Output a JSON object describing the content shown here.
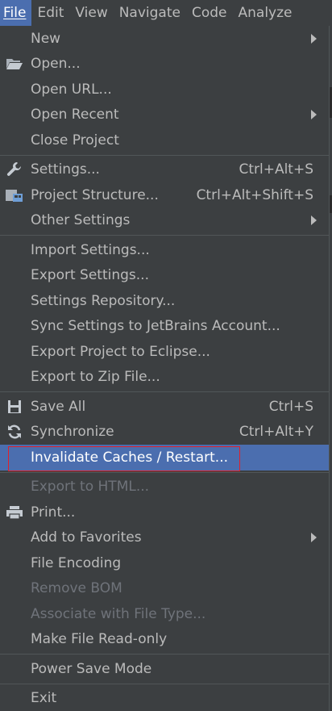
{
  "menubar": {
    "items": [
      {
        "label": "File",
        "mnemonic": "F"
      },
      {
        "label": "Edit",
        "mnemonic": "E"
      },
      {
        "label": "View",
        "mnemonic": "V"
      },
      {
        "label": "Navigate",
        "mnemonic": "N"
      },
      {
        "label": "Code",
        "mnemonic": "C"
      },
      {
        "label": "Analyze",
        "mnemonic": "z"
      }
    ]
  },
  "file_menu": {
    "new": "New",
    "open": "Open...",
    "open_url": "Open URL...",
    "open_recent": "Open Recent",
    "close_project": "Close Project",
    "settings": "Settings...",
    "settings_shortcut": "Ctrl+Alt+S",
    "project_structure": "Project Structure...",
    "project_structure_shortcut": "Ctrl+Alt+Shift+S",
    "other_settings": "Other Settings",
    "import_settings": "Import Settings...",
    "export_settings": "Export Settings...",
    "settings_repository": "Settings Repository...",
    "sync_settings": "Sync Settings to JetBrains Account...",
    "export_eclipse": "Export Project to Eclipse...",
    "export_zip": "Export to Zip File...",
    "save_all": "Save All",
    "save_all_shortcut": "Ctrl+S",
    "synchronize": "Synchronize",
    "synchronize_shortcut": "Ctrl+Alt+Y",
    "invalidate_caches": "Invalidate Caches / Restart...",
    "export_html": "Export to HTML...",
    "print": "Print...",
    "add_favorites": "Add to Favorites",
    "file_encoding": "File Encoding",
    "remove_bom": "Remove BOM",
    "associate_file_type": "Associate with File Type...",
    "make_read_only": "Make File Read-only",
    "power_save_mode": "Power Save Mode",
    "exit": "Exit"
  },
  "colors": {
    "menu_bg": "#3c3f41",
    "selection": "#4b6eaf",
    "text": "#bbbbbb",
    "disabled_text": "#6f737a",
    "annotation_box": "#e0202a"
  },
  "icons": {
    "open": "folder-open-icon",
    "settings": "wrench-icon",
    "project_structure": "project-structure-icon",
    "save_all": "floppy-disk-icon",
    "synchronize": "refresh-icon",
    "print": "printer-icon",
    "submenu": "chevron-right-icon"
  }
}
